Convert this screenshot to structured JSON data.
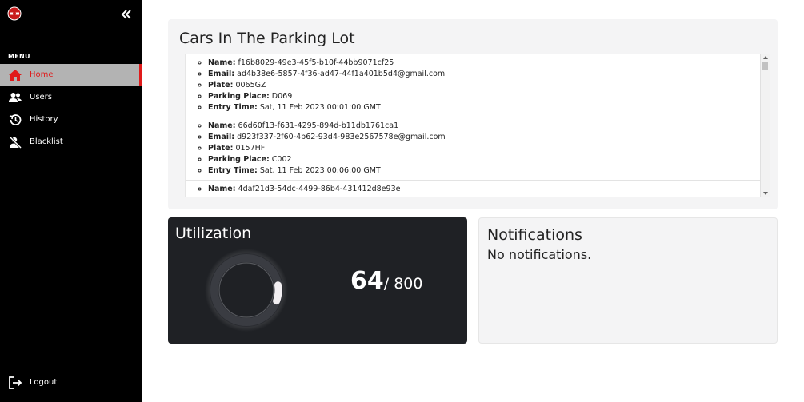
{
  "sidebar": {
    "menu_label": "MENU",
    "items": [
      {
        "label": "Home",
        "icon": "home-icon",
        "active": true
      },
      {
        "label": "Users",
        "icon": "users-icon",
        "active": false
      },
      {
        "label": "History",
        "icon": "history-icon",
        "active": false
      },
      {
        "label": "Blacklist",
        "icon": "blacklist-icon",
        "active": false
      }
    ],
    "logout_label": "Logout",
    "accent_color": "#e01a1a"
  },
  "cars": {
    "title": "Cars In The Parking Lot",
    "field_labels": {
      "name": "Name:",
      "email": "Email:",
      "plate": "Plate:",
      "place": "Parking Place:",
      "entry": "Entry Time:"
    },
    "entries": [
      {
        "name": "f16b8029-49e3-45f5-b10f-44bb9071cf25",
        "email": "ad4b38e6-5857-4f36-ad47-44f1a401b5d4@gmail.com",
        "plate": "0065GZ",
        "place": "D069",
        "entry": "Sat, 11 Feb 2023 00:01:00 GMT"
      },
      {
        "name": "66d60f13-f631-4295-894d-b11db1761ca1",
        "email": "d923f337-2f60-4b62-93d4-983e2567578e@gmail.com",
        "plate": "0157HF",
        "place": "C002",
        "entry": "Sat, 11 Feb 2023 00:06:00 GMT"
      },
      {
        "name": "4daf21d3-54dc-4499-86b4-431412d8e93e"
      }
    ]
  },
  "utilization": {
    "title": "Utilization",
    "occupied": "64",
    "separator": "/ 800",
    "fraction": 0.08
  },
  "notifications": {
    "title": "Notifications",
    "message": "No notifications."
  }
}
